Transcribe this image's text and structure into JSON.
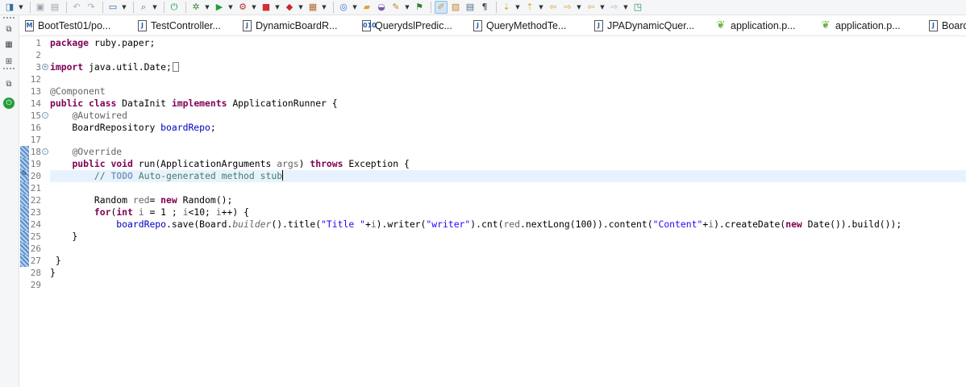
{
  "toolbar": {
    "buttons": [
      {
        "icon": "new-icon",
        "glyph": "◨",
        "color": "#3a6ea5",
        "dropdown": true
      },
      {
        "icon": "save-icon",
        "glyph": "▣",
        "color": "#9aa3ad"
      },
      {
        "icon": "save-all-icon",
        "glyph": "▤",
        "color": "#9aa3ad"
      },
      {
        "icon": "undo-icon",
        "glyph": "↶",
        "color": "#a8b0b8"
      },
      {
        "icon": "redo-icon",
        "glyph": "↷",
        "color": "#a8b0b8"
      },
      {
        "icon": "terminal-icon",
        "glyph": "▭",
        "color": "#2d5f96",
        "dropdown": true
      },
      {
        "icon": "search-icon",
        "glyph": "⌕",
        "color": "#3c6aa0",
        "dropdown": true
      },
      {
        "icon": "run-server-icon",
        "glyph": "⏻",
        "color": "#159a36"
      },
      {
        "icon": "debug-icon",
        "glyph": "✲",
        "color": "#4b7f3a",
        "dropdown": true
      },
      {
        "icon": "run-icon",
        "glyph": "▶",
        "color": "#1f9e3a",
        "dropdown": true
      },
      {
        "icon": "external-tools-icon",
        "glyph": "⚙",
        "color": "#b5302f",
        "dropdown": true
      },
      {
        "icon": "stop-icon",
        "glyph": "■",
        "color": "#d32f2f",
        "dropdown": true
      },
      {
        "icon": "launch-icon",
        "glyph": "◆",
        "color": "#c62828",
        "dropdown": true
      },
      {
        "icon": "package-icon",
        "glyph": "▦",
        "color": "#b0692a",
        "dropdown": true
      },
      {
        "icon": "new-wizard-icon",
        "glyph": "◎",
        "color": "#3d7bbf",
        "dropdown": true
      },
      {
        "icon": "open-folder-icon",
        "glyph": "▰",
        "color": "#d9a43a"
      },
      {
        "icon": "open-type-icon",
        "glyph": "◒",
        "color": "#7b5aa6"
      },
      {
        "icon": "open-task-icon",
        "glyph": "✎",
        "color": "#c08a2a",
        "dropdown": true
      },
      {
        "icon": "pin-icon",
        "glyph": "⚑",
        "color": "#2f7d32"
      },
      {
        "icon": "mark-occurrences-icon",
        "glyph": "✐",
        "color": "#c9a227",
        "active": true
      },
      {
        "icon": "block-selection-icon",
        "glyph": "▧",
        "color": "#c08a2a"
      },
      {
        "icon": "show-source-icon",
        "glyph": "▤",
        "color": "#4a6d93"
      },
      {
        "icon": "whitespace-icon",
        "glyph": "¶",
        "color": "#444444"
      },
      {
        "icon": "next-annotation-icon",
        "glyph": "⇣",
        "color": "#d9a43a",
        "dropdown": true
      },
      {
        "icon": "prev-annotation-icon",
        "glyph": "⇡",
        "color": "#d9a43a",
        "dropdown": true
      },
      {
        "icon": "last-edit-icon",
        "glyph": "⇦",
        "color": "#d9a43a"
      },
      {
        "icon": "back-forward-icon",
        "glyph": "⇨",
        "color": "#d9a43a",
        "dropdown": true
      },
      {
        "icon": "back-icon",
        "glyph": "⇦",
        "color": "#d9a43a",
        "dropdown": true
      },
      {
        "icon": "forward-icon",
        "glyph": "⇨",
        "color": "#b9b9b9",
        "dropdown": true
      },
      {
        "icon": "pin-editor-icon",
        "glyph": "◳",
        "color": "#2a8f5d"
      }
    ]
  },
  "tabs": [
    {
      "label": "BootTest01/po...",
      "icon": "maven-pom-icon",
      "glyph": "M",
      "leaf": false
    },
    {
      "label": "TestController...",
      "icon": "java-file-icon",
      "glyph": "J",
      "leaf": false
    },
    {
      "label": "DynamicBoardR...",
      "icon": "java-file-icon",
      "glyph": "J",
      "leaf": false
    },
    {
      "label": "QuerydslPredic...",
      "icon": "class-file-icon",
      "glyph": "010",
      "leaf": false
    },
    {
      "label": "QueryMethodTe...",
      "icon": "java-file-icon",
      "glyph": "J",
      "leaf": false
    },
    {
      "label": "JPADynamicQuer...",
      "icon": "java-file-icon",
      "glyph": "J",
      "leaf": false
    },
    {
      "label": "application.p...",
      "icon": "spring-leaf-icon",
      "glyph": "❦",
      "leaf": true
    },
    {
      "label": "application.p...",
      "icon": "spring-leaf-icon",
      "glyph": "❦",
      "leaf": true
    },
    {
      "label": "Board",
      "icon": "java-file-icon",
      "glyph": "J",
      "leaf": false
    }
  ],
  "trim": [
    {
      "icon": "restore-icon",
      "glyph": "⧉"
    },
    {
      "icon": "package-explorer-icon",
      "glyph": "▦"
    },
    {
      "icon": "type-hierarchy-icon",
      "glyph": "⊞"
    },
    {
      "icon": "restore-icon",
      "glyph": "⧉"
    },
    {
      "icon": "servers-icon",
      "glyph": "⏻"
    }
  ],
  "editor": {
    "current_line": "20",
    "lines": [
      {
        "n": "1",
        "tokens": [
          [
            "kw",
            "package"
          ],
          [
            "t",
            " ruby.paper;"
          ]
        ]
      },
      {
        "n": "2",
        "tokens": []
      },
      {
        "n": "3",
        "fold": "+",
        "tokens": [
          [
            "kw",
            "import"
          ],
          [
            "t",
            " java.util.Date;"
          ],
          [
            "box",
            ""
          ]
        ]
      },
      {
        "n": "12",
        "tokens": []
      },
      {
        "n": "13",
        "tokens": [
          [
            "ann",
            "@Component"
          ]
        ]
      },
      {
        "n": "14",
        "tokens": [
          [
            "kw",
            "public"
          ],
          [
            "t",
            " "
          ],
          [
            "kw",
            "class"
          ],
          [
            "t",
            " DataInit "
          ],
          [
            "kw",
            "implements"
          ],
          [
            "t",
            " ApplicationRunner {"
          ]
        ]
      },
      {
        "n": "15",
        "fold": "-",
        "tokens": [
          [
            "t",
            "    "
          ],
          [
            "ann",
            "@Autowired"
          ]
        ]
      },
      {
        "n": "16",
        "tokens": [
          [
            "t",
            "    BoardRepository "
          ],
          [
            "field",
            "boardRepo"
          ],
          [
            "t",
            ";"
          ]
        ]
      },
      {
        "n": "17",
        "tokens": []
      },
      {
        "n": "18",
        "fold": "-",
        "mark": true,
        "tokens": [
          [
            "t",
            "    "
          ],
          [
            "ann",
            "@Override"
          ]
        ]
      },
      {
        "n": "19",
        "mark": true,
        "tokens": [
          [
            "t",
            "    "
          ],
          [
            "kw",
            "public"
          ],
          [
            "t",
            " "
          ],
          [
            "kw",
            "void"
          ],
          [
            "t",
            " run(ApplicationArguments "
          ],
          [
            "ann",
            "args"
          ],
          [
            "t",
            ") "
          ],
          [
            "kw",
            "throws"
          ],
          [
            "t",
            " Exception {"
          ]
        ]
      },
      {
        "n": "20",
        "mark": true,
        "edit": true,
        "tokens": [
          [
            "t",
            "        "
          ],
          [
            "com",
            "// "
          ],
          [
            "task",
            "TODO"
          ],
          [
            "com",
            " Auto-generated method stub"
          ],
          [
            "caret",
            ""
          ]
        ]
      },
      {
        "n": "21",
        "mark": true,
        "tokens": []
      },
      {
        "n": "22",
        "mark": true,
        "tokens": [
          [
            "t",
            "        Random "
          ],
          [
            "ann",
            "red"
          ],
          [
            "t",
            "= "
          ],
          [
            "kw",
            "new"
          ],
          [
            "t",
            " Random();"
          ]
        ]
      },
      {
        "n": "23",
        "mark": true,
        "tokens": [
          [
            "t",
            "        "
          ],
          [
            "kw",
            "for"
          ],
          [
            "t",
            "("
          ],
          [
            "kw",
            "int"
          ],
          [
            "t",
            " "
          ],
          [
            "ann",
            "i"
          ],
          [
            "t",
            " = 1 ; "
          ],
          [
            "ann",
            "i"
          ],
          [
            "t",
            "<10; "
          ],
          [
            "ann",
            "i"
          ],
          [
            "t",
            "++) {"
          ]
        ]
      },
      {
        "n": "24",
        "mark": true,
        "tokens": [
          [
            "t",
            "            "
          ],
          [
            "field",
            "boardRepo"
          ],
          [
            "t",
            ".save(Board."
          ],
          [
            "static",
            "builder"
          ],
          [
            "t",
            "().title("
          ],
          [
            "str",
            "\"Title \""
          ],
          [
            "t",
            "+"
          ],
          [
            "ann",
            "i"
          ],
          [
            "t",
            ").writer("
          ],
          [
            "str",
            "\"writer\""
          ],
          [
            "t",
            ").cnt("
          ],
          [
            "ann",
            "red"
          ],
          [
            "t",
            ".nextLong(100)).content("
          ],
          [
            "str",
            "\"Content\""
          ],
          [
            "t",
            "+"
          ],
          [
            "ann",
            "i"
          ],
          [
            "t",
            ").createDate("
          ],
          [
            "kw",
            "new"
          ],
          [
            "t",
            " Date()).build());"
          ]
        ]
      },
      {
        "n": "25",
        "mark": true,
        "tokens": [
          [
            "t",
            "    }"
          ]
        ]
      },
      {
        "n": "26",
        "mark": true,
        "tokens": []
      },
      {
        "n": "27",
        "mark": true,
        "tokens": [
          [
            "t",
            " }"
          ]
        ]
      },
      {
        "n": "28",
        "tokens": [
          [
            "t",
            "}"
          ]
        ]
      },
      {
        "n": "29",
        "tokens": []
      }
    ]
  }
}
